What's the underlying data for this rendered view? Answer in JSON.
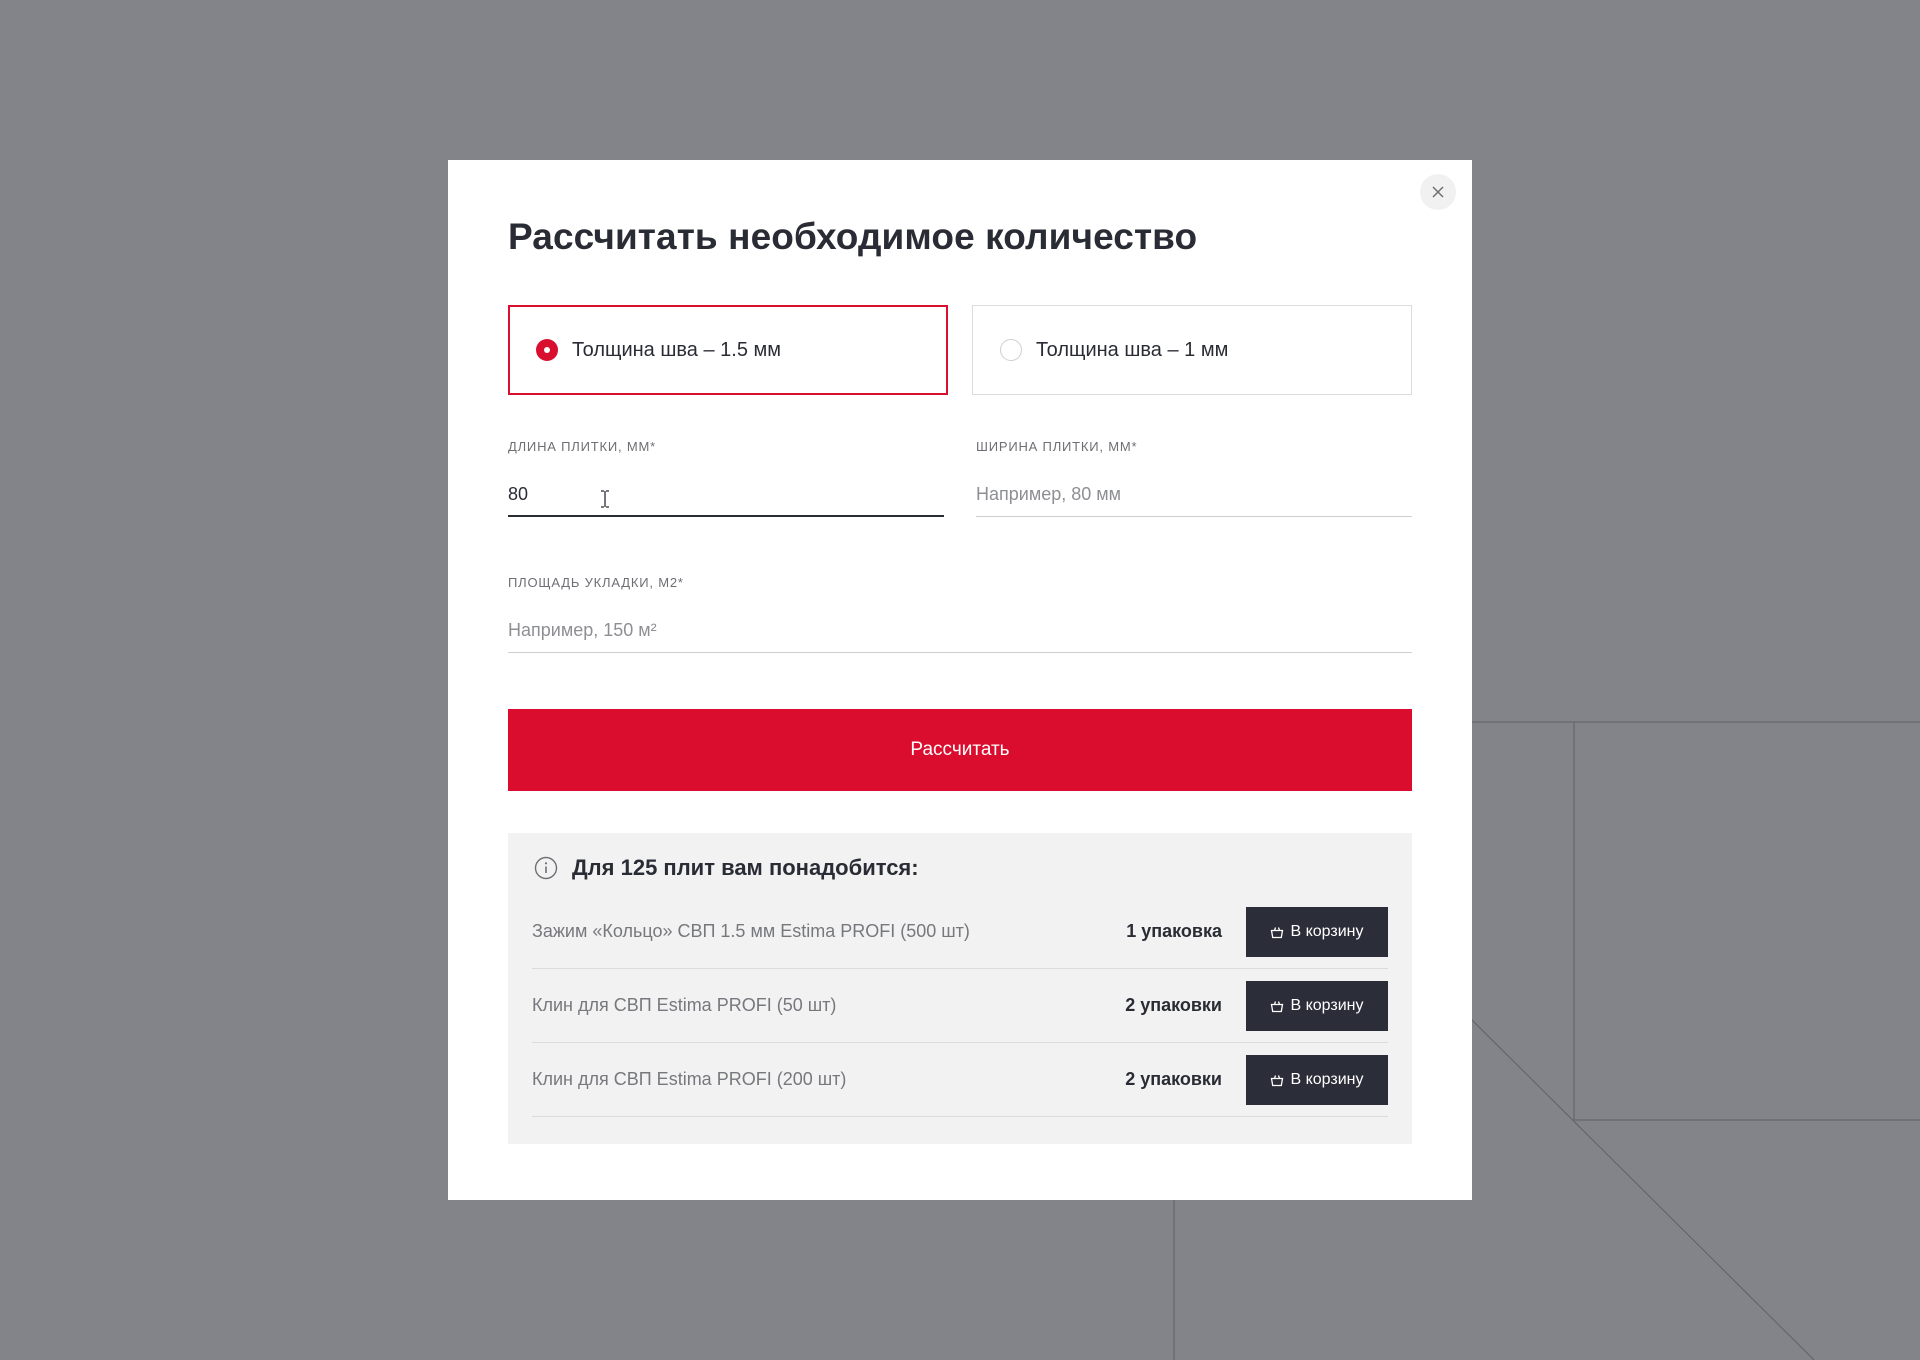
{
  "modal": {
    "title": "Рассчитать необходимое количество",
    "options": [
      {
        "label": "Толщина шва – 1.5 мм",
        "selected": true
      },
      {
        "label": "Толщина шва – 1 мм",
        "selected": false
      }
    ],
    "fields": {
      "length": {
        "label": "ДЛИНА ПЛИТКИ, ММ*",
        "value": "80",
        "placeholder": ""
      },
      "width": {
        "label": "ШИРИНА ПЛИТКИ, ММ*",
        "value": "",
        "placeholder": "Например, 80 мм"
      },
      "area": {
        "label": "ПЛОЩАДЬ УКЛАДКИ, М2*",
        "value": "",
        "placeholder": "Например, 150 м²"
      }
    },
    "calculate_label": "Рассчитать",
    "result": {
      "heading": "Для 125 плит вам понадобится:",
      "items": [
        {
          "name": "Зажим «Кольцо» СВП 1.5 мм Estima PROFI (500 шт)",
          "qty": "1 упаковка",
          "button": "В корзину"
        },
        {
          "name": "Клин для СВП Estima PROFI (50 шт)",
          "qty": "2 упаковки",
          "button": "В корзину"
        },
        {
          "name": "Клин для СВП Estima PROFI (200 шт)",
          "qty": "2 упаковки",
          "button": "В корзину"
        }
      ]
    }
  },
  "colors": {
    "accent": "#db0d2e",
    "dark": "#2a2c35",
    "overlay": "#838489"
  },
  "icons": [
    "close-icon",
    "info-icon",
    "basket-icon",
    "text-cursor-icon"
  ]
}
